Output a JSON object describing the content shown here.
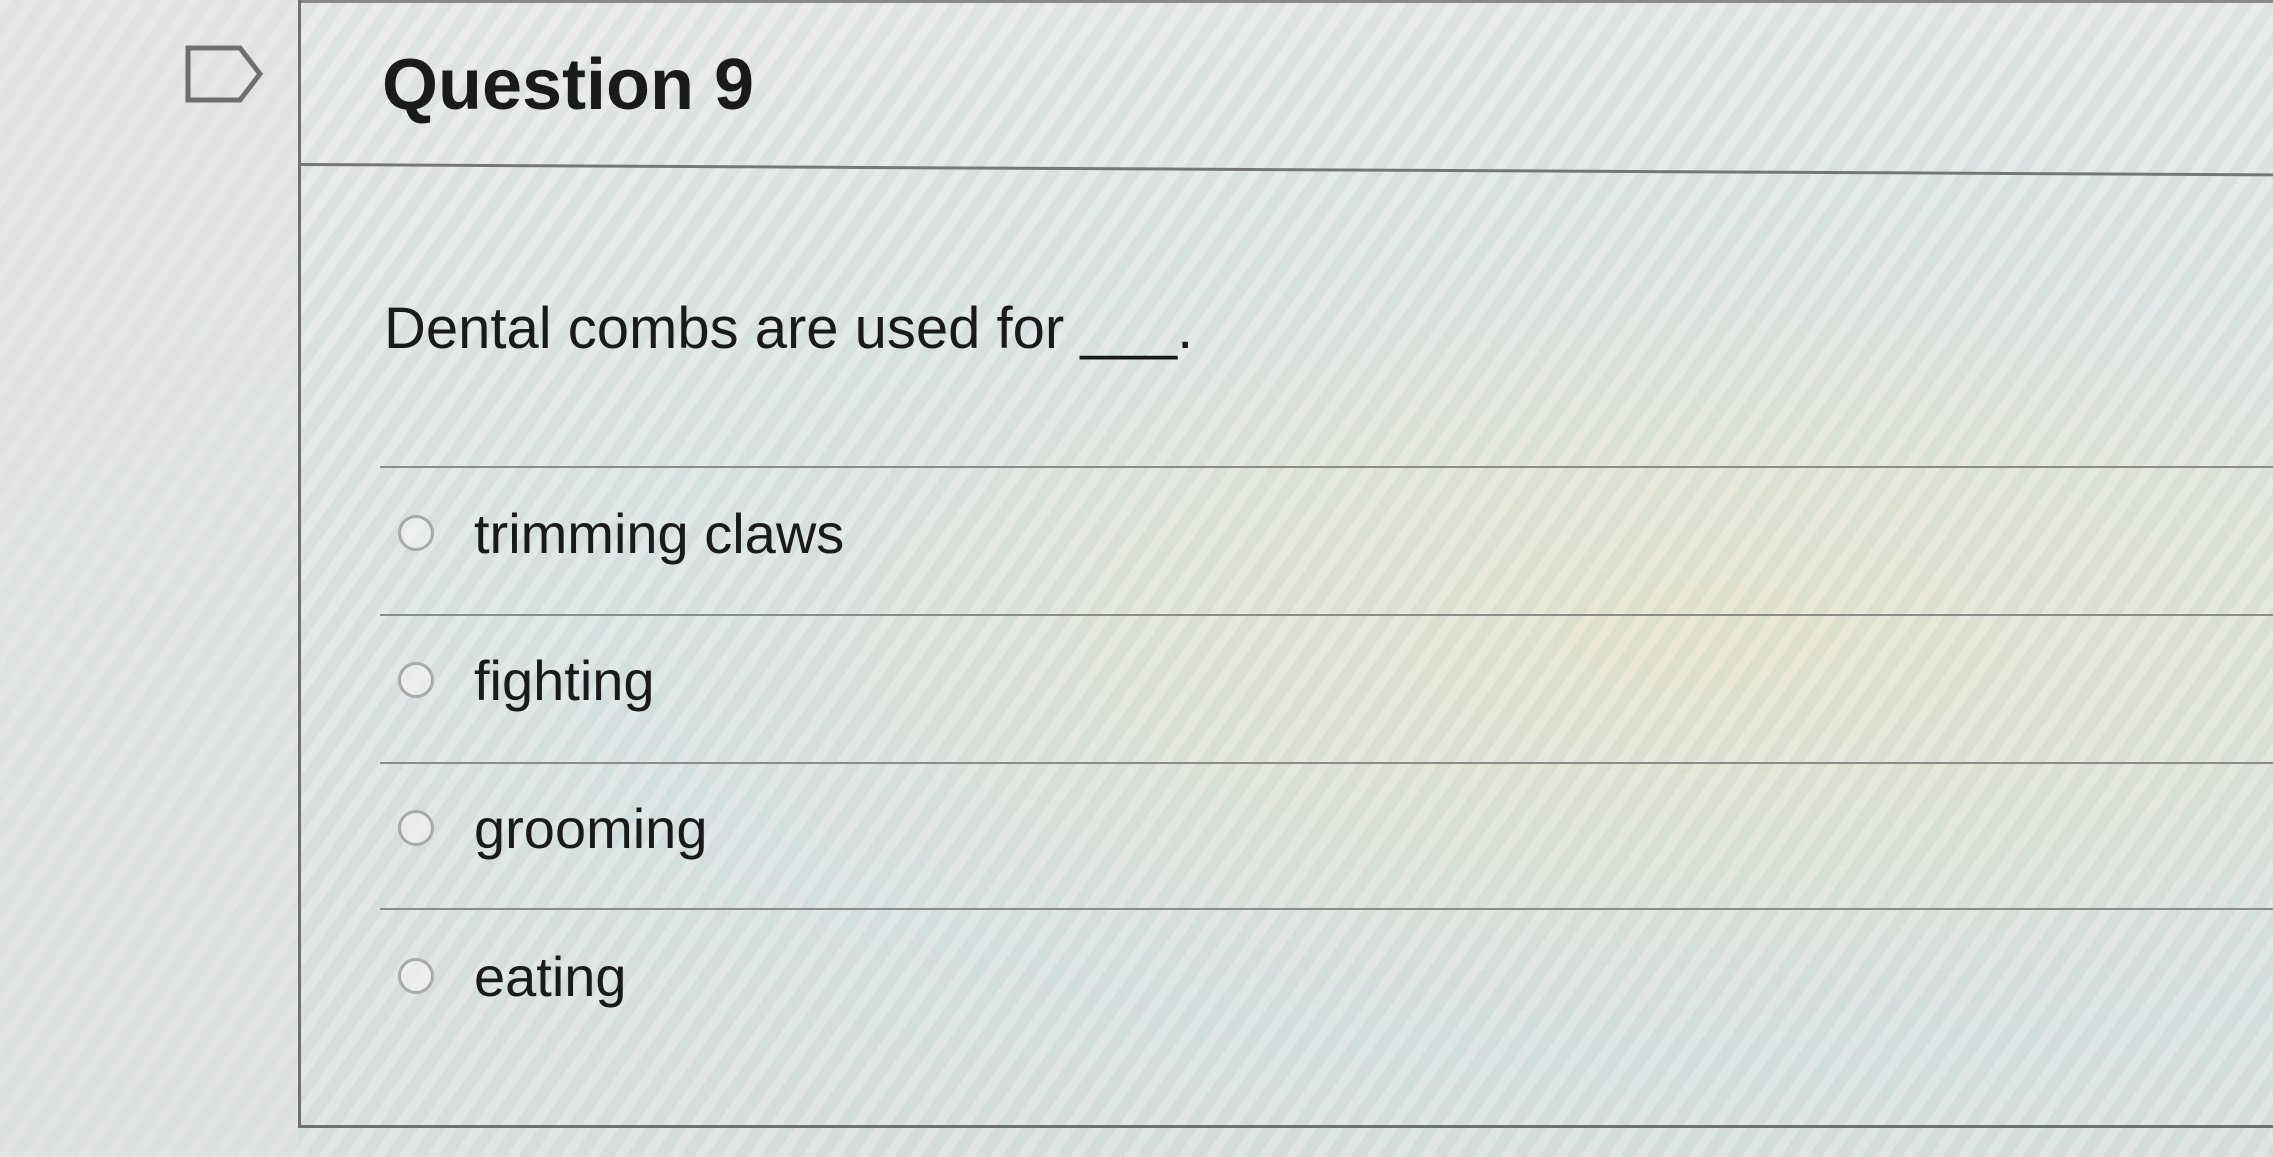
{
  "question": {
    "title": "Question 9",
    "text": "Dental combs are used for ___."
  },
  "options": [
    {
      "label": "trimming claws",
      "selected": false
    },
    {
      "label": "fighting",
      "selected": false
    },
    {
      "label": "grooming",
      "selected": false
    },
    {
      "label": "eating",
      "selected": false
    }
  ],
  "icons": {
    "flag": "flag-icon",
    "radio": "radio-button-icon"
  }
}
